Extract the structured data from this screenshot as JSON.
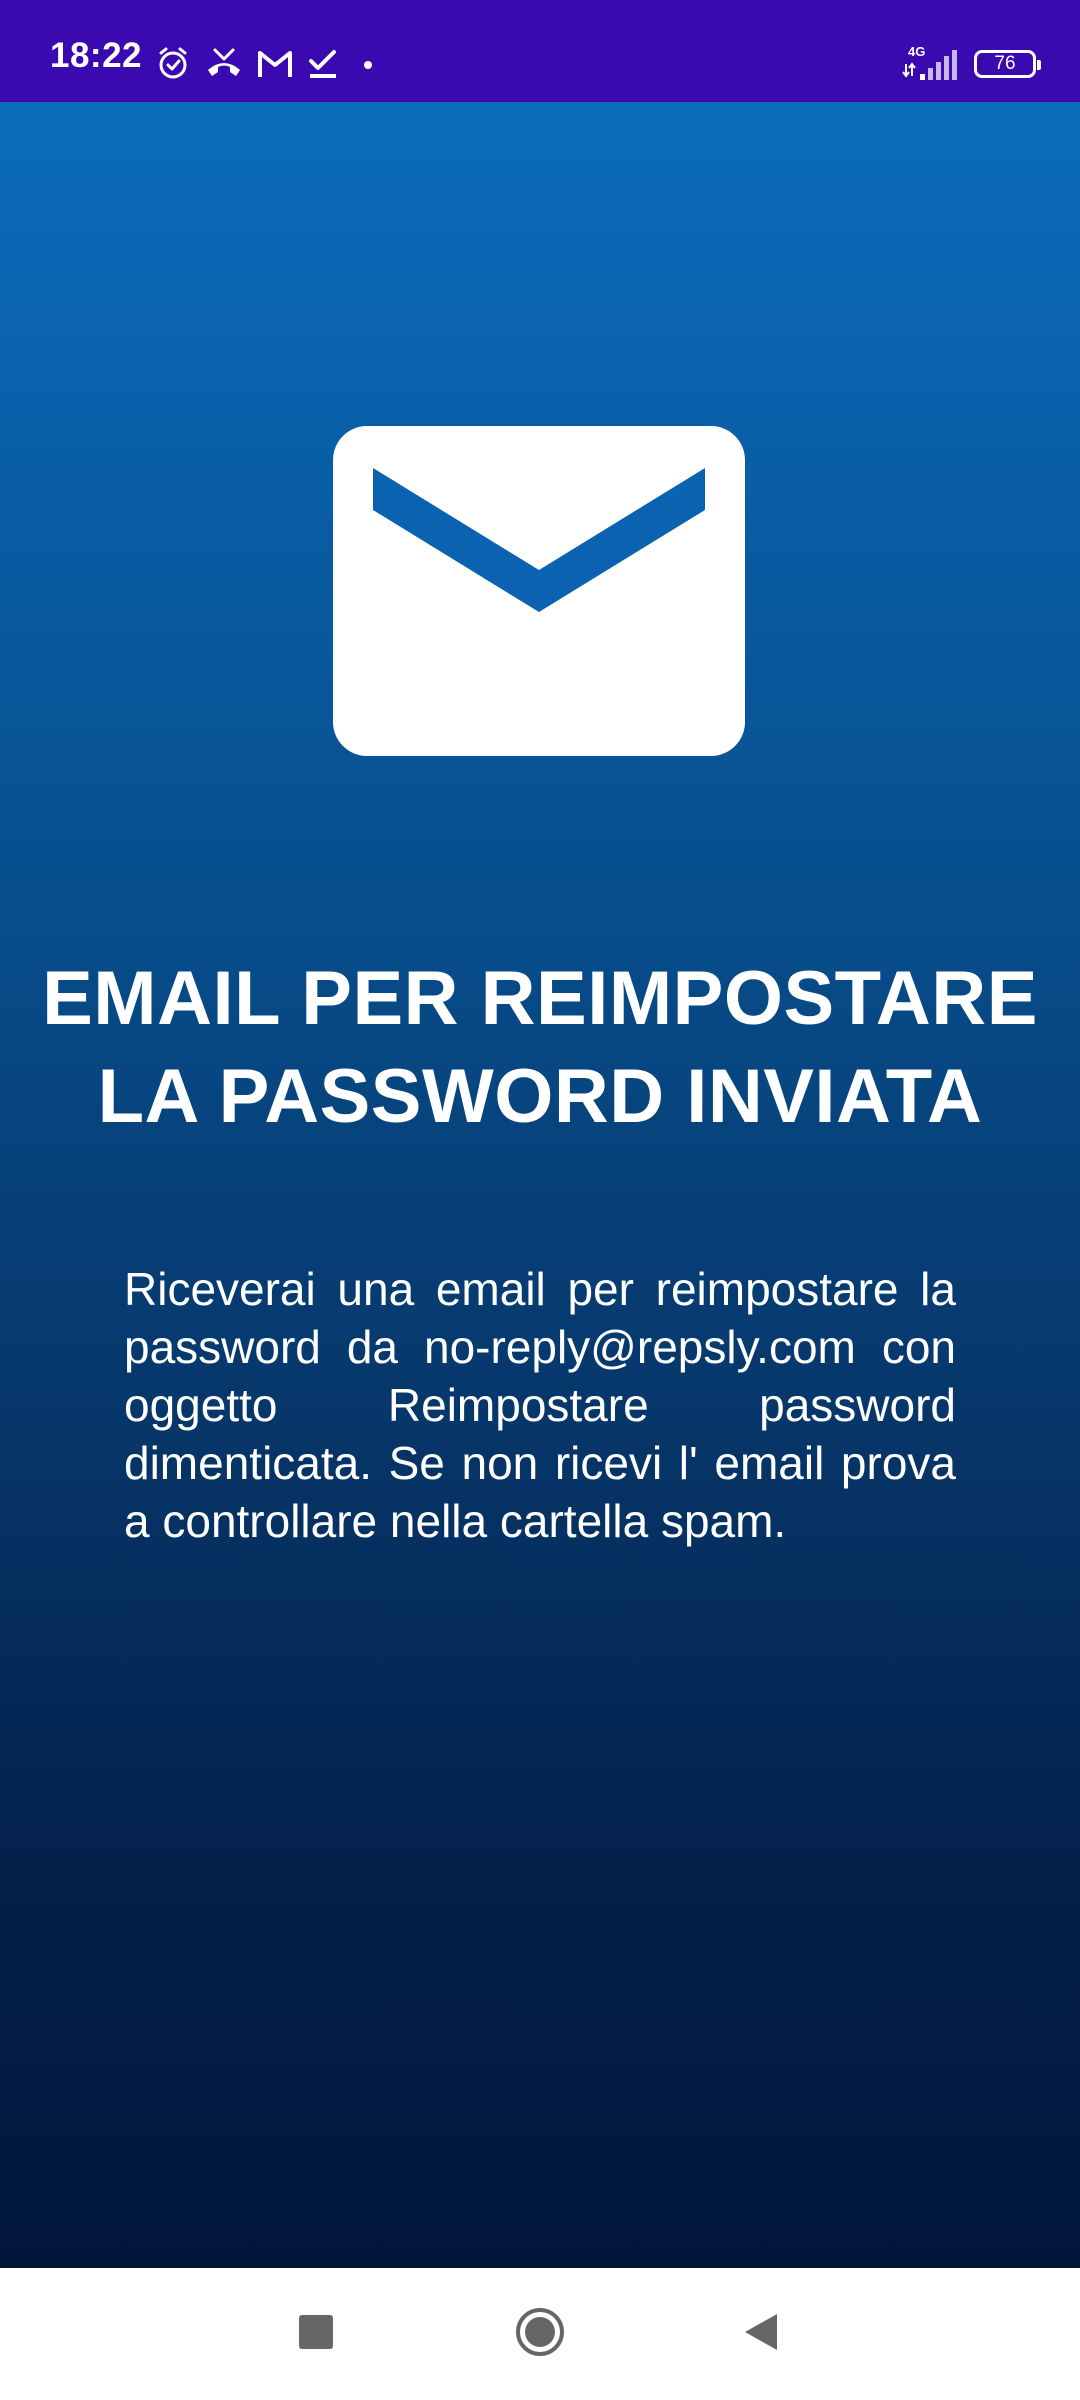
{
  "status_bar": {
    "time": "18:22",
    "left_icons": [
      "alarm-icon",
      "missed-call-icon",
      "gmail-icon",
      "task-done-icon",
      "dot-icon"
    ],
    "network_label": "4G",
    "battery_level": "76",
    "background_color": "#3a0ab0"
  },
  "content": {
    "icon": "mail-envelope-icon",
    "title_line_1": "EMAIL PER REIMPOSTARE",
    "title_line_2": "LA PASSWORD INVIATA",
    "message": "Riceverai una email per reimpostare la password da no-reply@repsly.com con oggetto Reimpostare password dimenticata. Se non ricevi l' email prova a controllare nella cartella spam.",
    "gradient_top_color": "#0b6cbc",
    "gradient_bottom_color": "#02163a"
  },
  "navigation_bar": {
    "buttons": [
      "recents-square-icon",
      "home-circle-icon",
      "back-triangle-icon"
    ]
  }
}
